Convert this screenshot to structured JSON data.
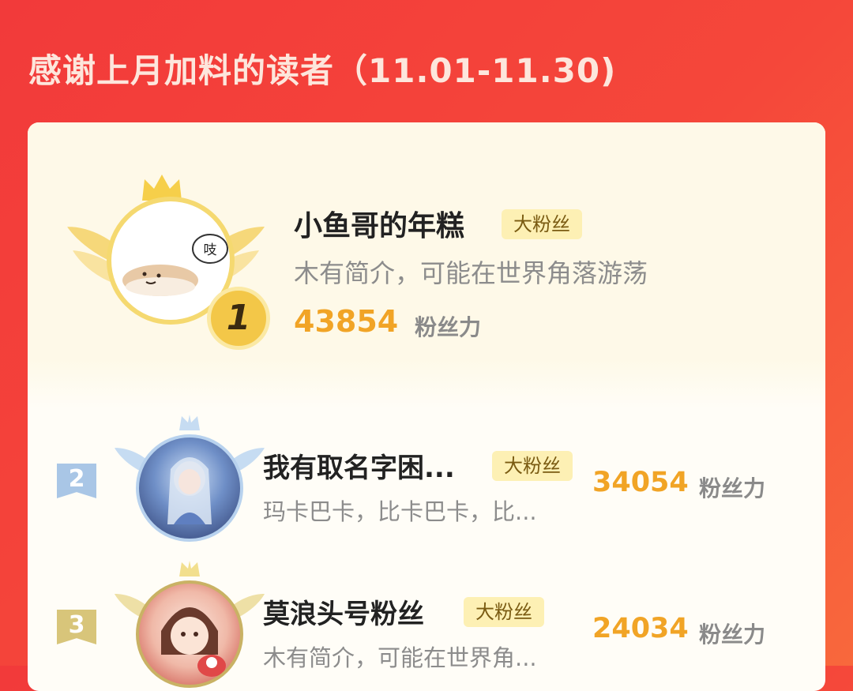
{
  "header": {
    "title": "感谢上月加料的读者（11.01-11.30)"
  },
  "top_fan": {
    "rank": "1",
    "name": "小鱼哥的年糕",
    "badge": "大粉丝",
    "bio": "木有简介，可能在世界角落游荡",
    "score": "43854",
    "score_unit": "粉丝力",
    "bubble_text": "吱"
  },
  "fans": [
    {
      "rank": "2",
      "name": "我有取名字困...",
      "badge": "大粉丝",
      "bio": "玛卡巴卡，比卡巴卡，比...",
      "score": "34054",
      "score_unit": "粉丝力"
    },
    {
      "rank": "3",
      "name": "莫浪头号粉丝",
      "badge": "大粉丝",
      "bio": "木有简介，可能在世界角...",
      "score": "24034",
      "score_unit": "粉丝力"
    }
  ],
  "colors": {
    "background": "#f23a3a",
    "score": "#f1a426",
    "gold": "#f3c748",
    "silver": "#a9c6e6",
    "bronze": "#d8c57a"
  },
  "icons": {
    "crown": "crown-icon",
    "wings": "wings-icon",
    "rank_medal": "rank-medal-icon"
  }
}
